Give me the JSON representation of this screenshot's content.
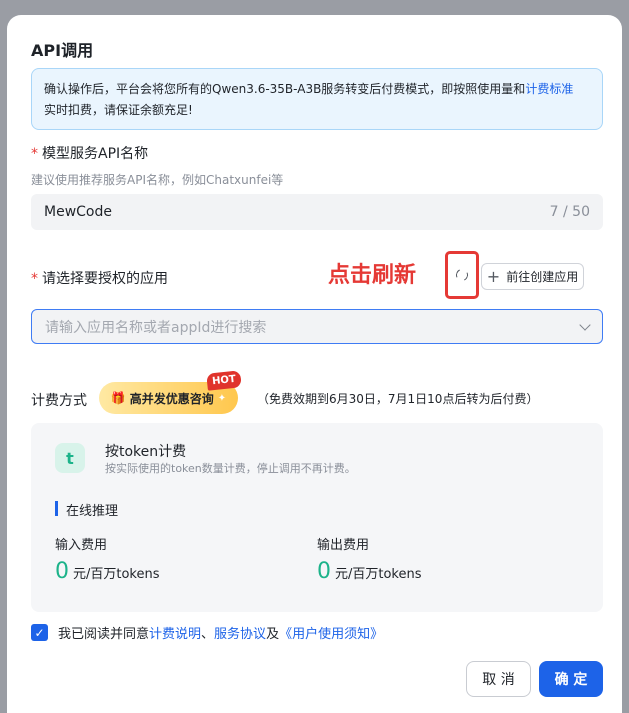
{
  "dialog": {
    "title": "API调用",
    "notice_part1": "确认操作后，平台会将您所有的Qwen3.6-35B-A3B服务转变后付费模式，即按照使用量和",
    "notice_link": "计费标准",
    "notice_part2": "实时扣费，请保证余额充足!"
  },
  "service_name": {
    "required_mark": "*",
    "label": "模型服务API名称",
    "hint": "建议使用推荐服务API名称，例如Chatxunfei等",
    "value": "MewCode",
    "counter": "7 / 50"
  },
  "app_select": {
    "required_mark": "*",
    "label": "请选择要授权的应用",
    "annotation": "点击刷新",
    "create_button": "前往创建应用",
    "placeholder": "请输入应用名称或者appId进行搜索"
  },
  "billing": {
    "label": "计费方式",
    "promo_label": "高并发优惠咨询",
    "hot_badge": "HOT",
    "promo_note": "（免费效期到6月30日，7月1日10点后转为后付费）",
    "card": {
      "title": "按token计费",
      "subtitle": "按实际使用的token数量计费，停止调用不再计费。",
      "section": "在线推理",
      "input_label": "输入费用",
      "input_value": "0",
      "input_unit": "元/百万tokens",
      "output_label": "输出费用",
      "output_value": "0",
      "output_unit": "元/百万tokens"
    }
  },
  "agreement": {
    "text": "我已阅读并同意",
    "link1": "计费说明",
    "sep": "、",
    "link2": "服务协议",
    "and": "及",
    "link3": "《用户使用须知》"
  },
  "footer": {
    "cancel": "取 消",
    "confirm": "确 定"
  },
  "colors": {
    "primary": "#1d63e8",
    "accent_green": "#1cb38a",
    "annotation_red": "#e53935"
  }
}
